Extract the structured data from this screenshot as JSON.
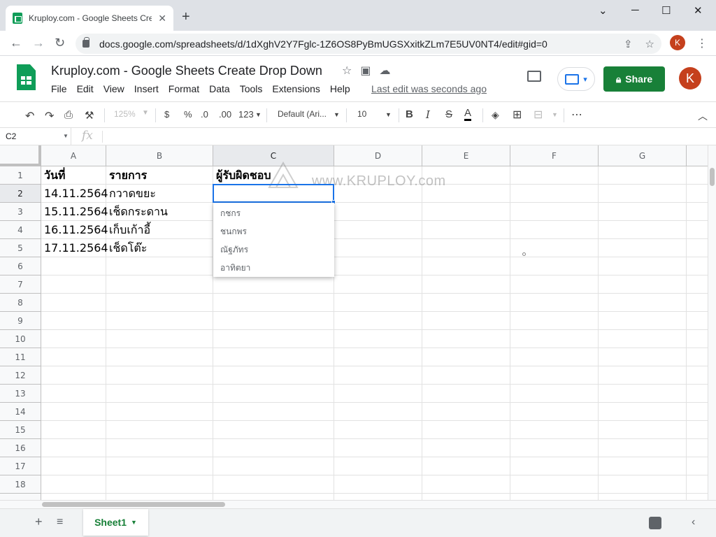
{
  "browser": {
    "tab_title": "Kruploy.com - Google Sheets Cre",
    "new_tab": "+",
    "url": "docs.google.com/spreadsheets/d/1dXghV2Y7Fglc-1Z6OS8PyBmUGSXxitkZLm7E5UV0NT4/edit#gid=0",
    "profile_initial": "K",
    "controls": {
      "minimize": "⌄",
      "min": "─",
      "max": "☐",
      "close": "✕"
    }
  },
  "sheets": {
    "title": "Kruploy.com - Google Sheets Create Drop Down",
    "menus": [
      "File",
      "Edit",
      "View",
      "Insert",
      "Format",
      "Data",
      "Tools",
      "Extensions",
      "Help"
    ],
    "last_edit": "Last edit was seconds ago",
    "share_label": "Share",
    "user_initial": "K"
  },
  "toolbar": {
    "zoom": "125%",
    "currency": "$",
    "percent": "%",
    "dec_less": ".0",
    "dec_more": ".00",
    "more_formats": "123",
    "font": "Default (Ari...",
    "font_size": "10",
    "bold": "B",
    "italic": "I",
    "strike": "S",
    "text_color": "A",
    "more": "⋯"
  },
  "formula_bar": {
    "name_box": "C2",
    "fx": "fx",
    "value": ""
  },
  "grid": {
    "columns": [
      "A",
      "B",
      "C",
      "D",
      "E",
      "F",
      "G"
    ],
    "rows": [
      "1",
      "2",
      "3",
      "4",
      "5",
      "6",
      "7",
      "8",
      "9",
      "10",
      "11",
      "12",
      "13",
      "14",
      "15",
      "16",
      "17",
      "18"
    ],
    "selected_cell": "C2",
    "cells": {
      "A1": "วันที่",
      "B1": "รายการ",
      "C1": "ผู้รับผิดชอบ",
      "A2": "14.11.2564",
      "B2": "กวาดขยะ",
      "A3": "15.11.2564",
      "B3": "เช็ดกระดาน",
      "A4": "16.11.2564",
      "B4": "เก็บเก้าอี้",
      "A5": "17.11.2564",
      "B5": "เช็ดโต๊ะ"
    },
    "dropdown_options": [
      "กชกร",
      "ชนกพร",
      "ณัฐภัทร",
      "อาทิตยา"
    ]
  },
  "watermark": "www.KRUPLOY.com",
  "bottom": {
    "sheet_name": "Sheet1"
  },
  "colors": {
    "accent": "#1a73e8",
    "share": "#188038",
    "avatar": "#c5401d",
    "sheets_green": "#0f9d58"
  }
}
